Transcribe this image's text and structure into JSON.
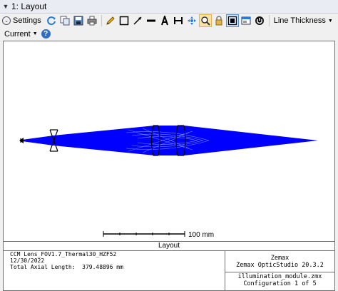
{
  "window": {
    "title": "1: Layout"
  },
  "toolbar": {
    "settings_label": "Settings",
    "line_thickness_label": "Line Thickness",
    "current_label": "Current",
    "icons": [
      "refresh-icon",
      "copy-icon",
      "save-icon",
      "print-icon",
      "pencil-icon",
      "rectangle-icon",
      "arrow-icon",
      "line-icon",
      "text-icon",
      "dimension-icon",
      "move-icon",
      "zoom-icon",
      "lock-icon",
      "fit-icon",
      "window-icon",
      "power-icon"
    ],
    "colors": {
      "active_highlight": "#fbe3a5",
      "pressed_highlight": "#cfe3f7"
    }
  },
  "plot": {
    "ray_color": "#0000ff",
    "scale_label": "100 mm"
  },
  "info": {
    "title": "Layout",
    "lens_name": "CCM Lens_FOV1.7_Thermal30_HZF52",
    "date": "12/30/2022",
    "axial_length": "Total Axial Length:  379.48896 mm",
    "company": "Zemax",
    "software": "Zemax OpticStudio 20.3.2",
    "file_name": "illumination_module.zmx",
    "configuration": "Configuration 1 of 5"
  }
}
